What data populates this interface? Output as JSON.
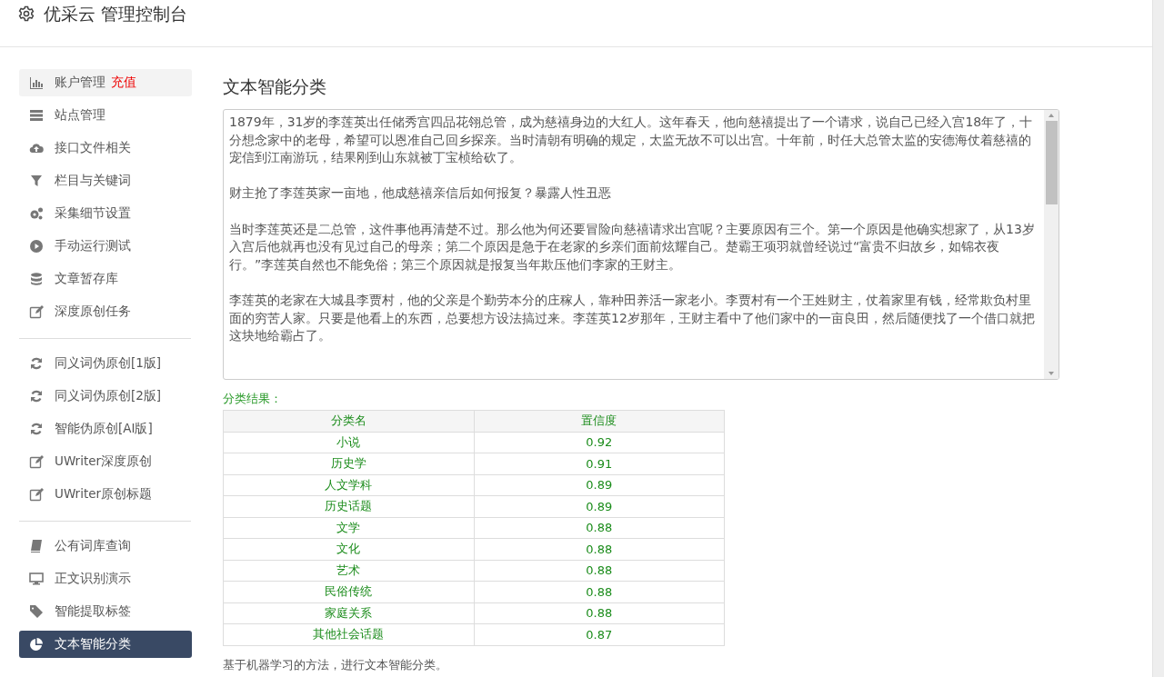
{
  "header": {
    "title": "优采云 管理控制台"
  },
  "sidebar": {
    "groups": [
      [
        {
          "label": "账户管理",
          "badge": "充值",
          "kind": "bars",
          "selected": false,
          "highlighted": true
        },
        {
          "label": "站点管理",
          "kind": "server",
          "selected": false,
          "highlighted": false
        },
        {
          "label": "接口文件相关",
          "kind": "cloud",
          "selected": false,
          "highlighted": false
        },
        {
          "label": "栏目与关键词",
          "kind": "filter",
          "selected": false,
          "highlighted": false
        },
        {
          "label": "采集细节设置",
          "kind": "gears",
          "selected": false,
          "highlighted": false
        },
        {
          "label": "手动运行测试",
          "kind": "play",
          "selected": false,
          "highlighted": false
        },
        {
          "label": "文章暂存库",
          "kind": "database",
          "selected": false,
          "highlighted": false
        },
        {
          "label": "深度原创任务",
          "kind": "edit",
          "selected": false,
          "highlighted": false
        }
      ],
      [
        {
          "label": "同义词伪原创[1版]",
          "kind": "refresh",
          "selected": false,
          "highlighted": false
        },
        {
          "label": "同义词伪原创[2版]",
          "kind": "refresh",
          "selected": false,
          "highlighted": false
        },
        {
          "label": "智能伪原创[AI版]",
          "kind": "refresh",
          "selected": false,
          "highlighted": false
        },
        {
          "label": "UWriter深度原创",
          "kind": "edit",
          "selected": false,
          "highlighted": false
        },
        {
          "label": "UWriter原创标题",
          "kind": "edit",
          "selected": false,
          "highlighted": false
        }
      ],
      [
        {
          "label": "公有词库查询",
          "kind": "book",
          "selected": false,
          "highlighted": false
        },
        {
          "label": "正文识别演示",
          "kind": "monitor",
          "selected": false,
          "highlighted": false
        },
        {
          "label": "智能提取标签",
          "kind": "tag",
          "selected": false,
          "highlighted": false
        },
        {
          "label": "文本智能分类",
          "kind": "pie",
          "selected": true,
          "highlighted": false
        }
      ]
    ]
  },
  "main": {
    "title": "文本智能分类",
    "text_input": {
      "paragraphs": [
        "1879年，31岁的李莲英出任储秀宫四品花翎总管，成为慈禧身边的大红人。这年春天，他向慈禧提出了一个请求，说自己已经入宫18年了，十分想念家中的老母，希望可以恩准自己回乡探亲。当时清朝有明确的规定，太监无故不可以出宫。十年前，时任大总管太监的安德海仗着慈禧的宠信到江南游玩，结果刚到山东就被丁宝桢给砍了。",
        "财主抢了李莲英家一亩地，他成慈禧亲信后如何报复？暴露人性丑恶",
        "当时李莲英还是二总管，这件事他再清楚不过。那么他为何还要冒险向慈禧请求出宫呢？主要原因有三个。第一个原因是他确实想家了，从13岁入宫后他就再也没有见过自己的母亲；第二个原因是急于在老家的乡亲们面前炫耀自己。楚霸王项羽就曾经说过“富贵不归故乡，如锦衣夜行。”李莲英自然也不能免俗；第三个原因就是报复当年欺压他们李家的王财主。",
        "李莲英的老家在大城县李贾村，他的父亲是个勤劳本分的庄稼人，靠种田养活一家老小。李贾村有一个王姓财主，仗着家里有钱，经常欺负村里面的穷苦人家。只要是他看上的东西，总要想方设法搞过来。李莲英12岁那年，王财主看中了他们家中的一亩良田，然后随便找了一个借口就把这块地给霸占了。"
      ]
    },
    "result_label": "分类结果：",
    "table": {
      "columns": [
        "分类名",
        "置信度"
      ],
      "rows": [
        [
          "小说",
          "0.92"
        ],
        [
          "历史学",
          "0.91"
        ],
        [
          "人文学科",
          "0.89"
        ],
        [
          "历史话题",
          "0.89"
        ],
        [
          "文学",
          "0.88"
        ],
        [
          "文化",
          "0.88"
        ],
        [
          "艺术",
          "0.88"
        ],
        [
          "民俗传统",
          "0.88"
        ],
        [
          "家庭关系",
          "0.88"
        ],
        [
          "其他社会话题",
          "0.87"
        ]
      ]
    },
    "description": "基于机器学习的方法，进行文本智能分类。"
  }
}
